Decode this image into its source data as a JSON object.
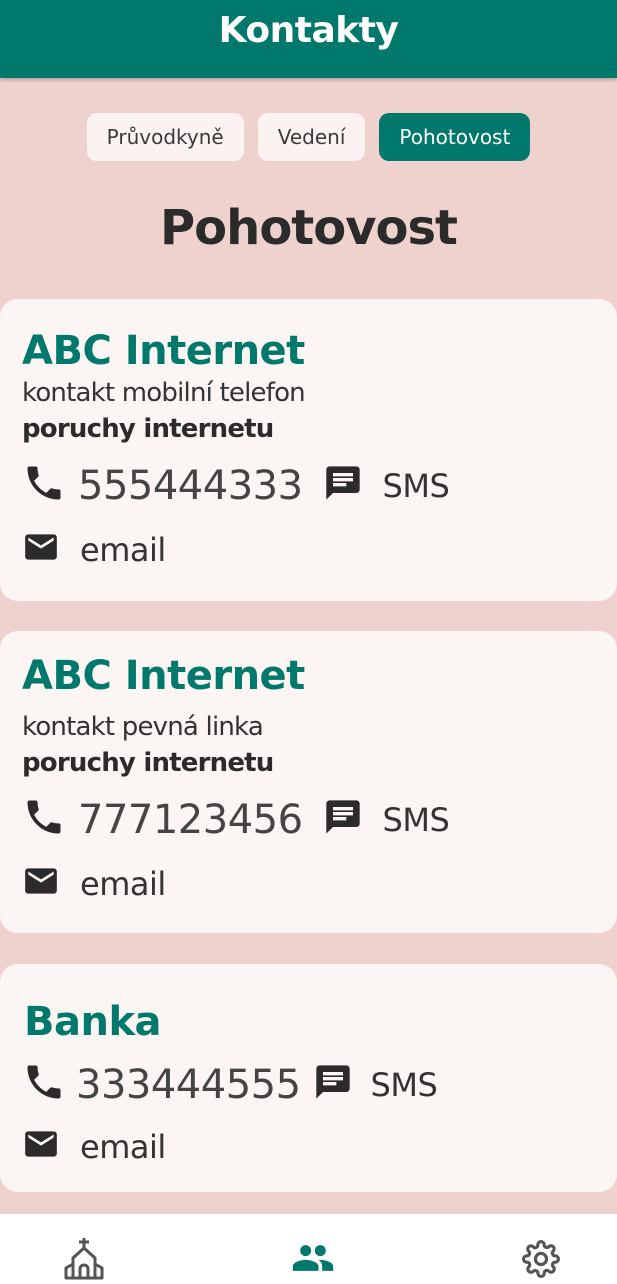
{
  "header": {
    "title": "Kontakty"
  },
  "tabs": [
    {
      "label": "Průvodkyně",
      "active": false
    },
    {
      "label": "Vedení",
      "active": false
    },
    {
      "label": "Pohotovost",
      "active": true
    }
  ],
  "section": {
    "title": "Pohotovost"
  },
  "contacts": [
    {
      "name": "ABC Internet",
      "description": "kontakt mobilní telefon",
      "note": "poruchy internetu",
      "phone": "555444333",
      "sms_label": "SMS",
      "email_label": "email"
    },
    {
      "name": "ABC Internet",
      "description": "kontakt pevná linka",
      "note": "poruchy internetu",
      "phone": "777123456",
      "sms_label": "SMS",
      "email_label": "email"
    },
    {
      "name": "Banka",
      "phone": "333444555",
      "sms_label": "SMS",
      "email_label": "email"
    }
  ],
  "bottom_nav": {
    "items": [
      {
        "icon": "church-icon",
        "active": false
      },
      {
        "icon": "people-icon",
        "active": true
      },
      {
        "icon": "gear-icon",
        "active": false
      }
    ]
  },
  "colors": {
    "primary": "#00786b",
    "background": "#efd2cd",
    "card": "#fbf5f3",
    "icon": "#2b2b2b"
  }
}
